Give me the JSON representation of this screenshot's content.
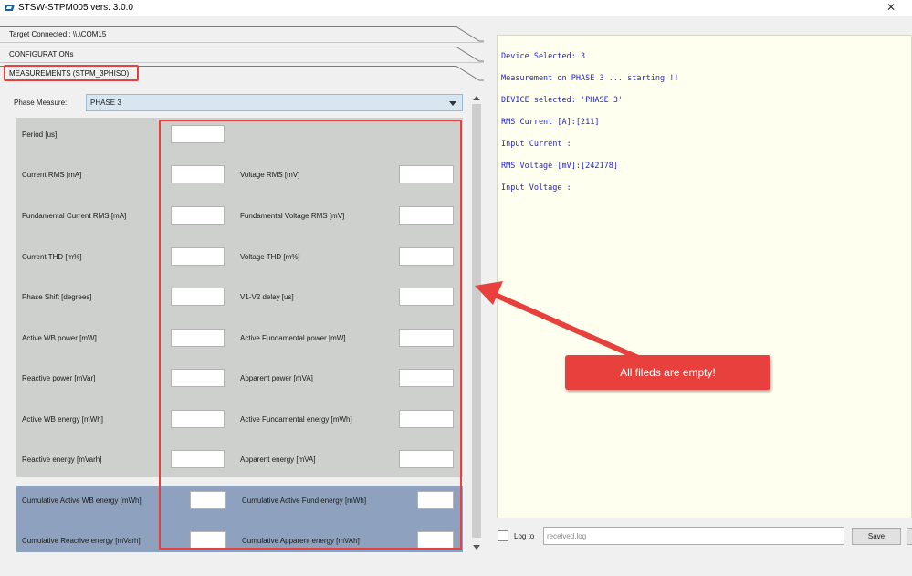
{
  "window": {
    "title": "STSW-STPM005 vers. 3.0.0",
    "close_glyph": "✕"
  },
  "accordion": [
    {
      "label": "Target Connected : \\\\.\\COM15"
    },
    {
      "label": "CONFIGURATIONs"
    },
    {
      "label": "MEASUREMENTS (STPM_3PHISO)"
    }
  ],
  "phase": {
    "label": "Phase Measure:",
    "selected": "PHASE 3"
  },
  "fields_left": [
    {
      "label": "Period [us]",
      "value": ""
    },
    {
      "label": "Current RMS [mA]",
      "value": ""
    },
    {
      "label": "Fundamental Current RMS [mA]",
      "value": ""
    },
    {
      "label": "Current THD [m%]",
      "value": ""
    },
    {
      "label": "Phase Shift [degrees]",
      "value": ""
    },
    {
      "label": "Active WB power [mW]",
      "value": ""
    },
    {
      "label": "Reactive power [mVar]",
      "value": ""
    },
    {
      "label": "Active WB energy [mWh]",
      "value": ""
    },
    {
      "label": "Reactive energy [mVarh]",
      "value": ""
    }
  ],
  "fields_right": [
    {
      "label": "Voltage RMS [mV]",
      "value": ""
    },
    {
      "label": "Fundamental Voltage RMS [mV]",
      "value": ""
    },
    {
      "label": "Voltage THD [m%]",
      "value": ""
    },
    {
      "label": "V1-V2 delay [us]",
      "value": ""
    },
    {
      "label": "Active Fundamental power [mW]",
      "value": ""
    },
    {
      "label": "Apparent power [mVA]",
      "value": ""
    },
    {
      "label": "Active Fundamental energy [mWh]",
      "value": ""
    },
    {
      "label": "Apparent energy [mVA]",
      "value": ""
    }
  ],
  "cumulative": [
    {
      "label": "Cumulative Active WB energy [mWh]",
      "value": ""
    },
    {
      "label": "Cumulative Active Fund energy [mWh]",
      "value": ""
    },
    {
      "label": "Cumulative Reactive energy [mVarh]",
      "value": ""
    },
    {
      "label": "Cumulative Apparent energy [mVAh]",
      "value": ""
    }
  ],
  "console": {
    "lines": [
      "Device Selected: 3",
      "Measurement on PHASE 3 ... starting !!",
      "DEVICE selected: 'PHASE 3'",
      "RMS Current [A]:[211]",
      "Input Current :",
      "RMS Voltage [mV]:[242178]",
      "Input Voltage :"
    ]
  },
  "log": {
    "checkbox_label": "Log to",
    "filename": "received.log",
    "save_label": "Save"
  },
  "annotation": {
    "text": "All fileds are empty!"
  },
  "colors": {
    "highlight": "#e8403c",
    "console_text": "#1f1fd0",
    "panel_gray": "#cdd0cd",
    "panel_blue": "#8ea2bf"
  }
}
